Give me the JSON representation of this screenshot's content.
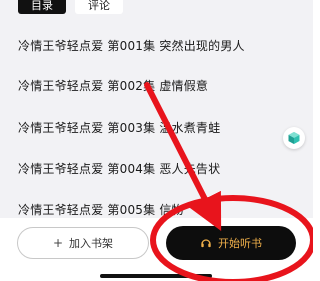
{
  "tabs": [
    {
      "label": "目录",
      "active": true
    },
    {
      "label": "评论",
      "active": false
    }
  ],
  "episodes": [
    "冷情王爷轻点爱 第001集 突然出现的男人",
    "冷情王爷轻点爱 第002集 虚情假意",
    "冷情王爷轻点爱 第003集 温水煮青蛙",
    "冷情王爷轻点爱 第004集 恶人先告状",
    "冷情王爷轻点爱 第005集 信物"
  ],
  "actions": {
    "add_shelf_label": "加入书架",
    "listen_label": "开始听书"
  },
  "colors": {
    "annotation_red": "#e8141c",
    "listen_text": "#f0b04a",
    "panel_bg": "#f2f2f5"
  }
}
